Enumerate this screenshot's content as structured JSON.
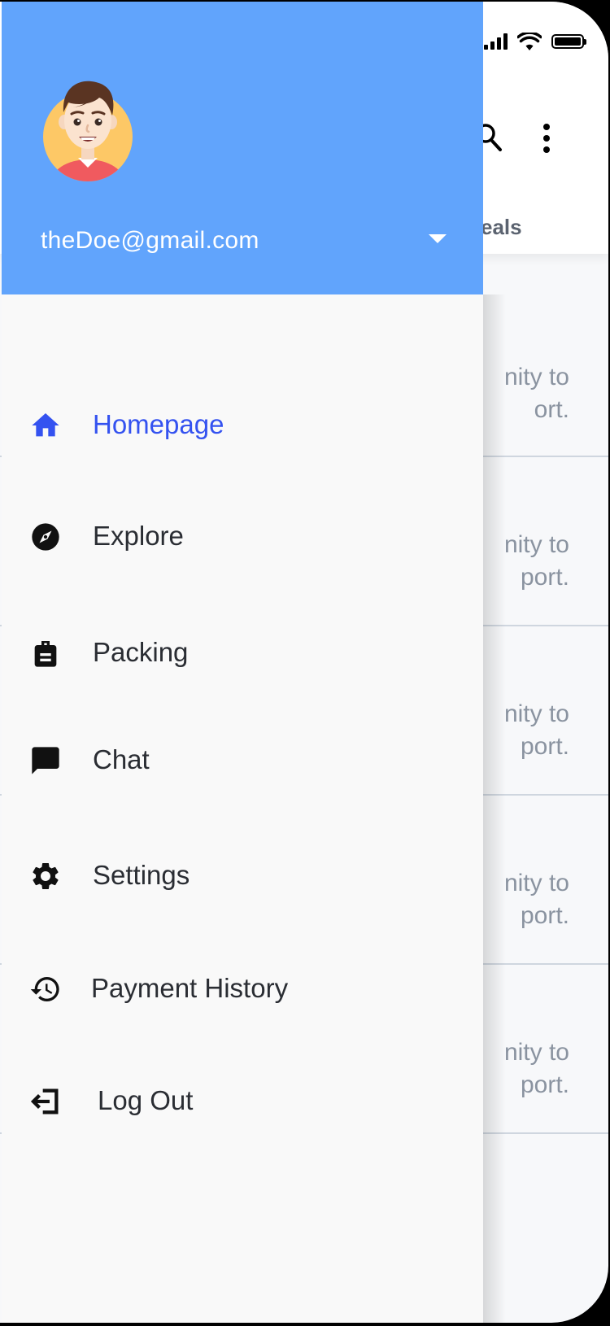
{
  "status_bar": {
    "icons": [
      "cellular-signal-icon",
      "wifi-icon",
      "battery-icon"
    ]
  },
  "app_bar": {
    "search_icon": "search-icon",
    "more_icon": "more-vertical-icon",
    "visible_tab_fragment": "eals"
  },
  "background_list": {
    "items": [
      {
        "line1": "nity to",
        "line2": "ort."
      },
      {
        "line1": "nity to",
        "line2": "port."
      },
      {
        "line1": "nity to",
        "line2": "port."
      },
      {
        "line1": "nity to",
        "line2": "port."
      },
      {
        "line1": "nity to",
        "line2": "port."
      }
    ]
  },
  "drawer": {
    "account": {
      "email": "theDoe@gmail.com",
      "toggle_icon": "arrow-drop-down-icon"
    },
    "menu": [
      {
        "label": "Homepage",
        "icon": "home-icon",
        "active": true
      },
      {
        "label": "Explore",
        "icon": "compass-icon",
        "active": false
      },
      {
        "label": "Packing",
        "icon": "backpack-icon",
        "active": false
      },
      {
        "label": "Chat",
        "icon": "chat-icon",
        "active": false
      },
      {
        "label": "Settings",
        "icon": "gear-icon",
        "active": false
      },
      {
        "label": "Payment History",
        "icon": "history-icon",
        "active": false
      },
      {
        "label": "Log Out",
        "icon": "logout-icon",
        "active": false
      }
    ]
  },
  "colors": {
    "drawer_header": "#61a4fc",
    "active_item": "#3452f0",
    "menu_text": "#2a2d33",
    "drawer_background": "#f9f9f9"
  }
}
